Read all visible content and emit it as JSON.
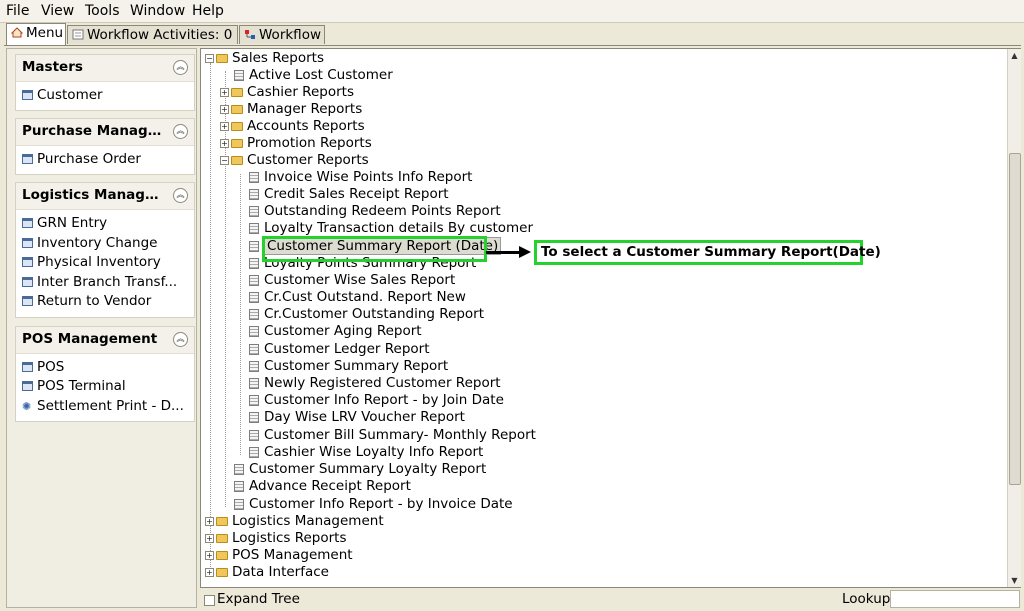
{
  "menubar": {
    "file": "File",
    "view": "View",
    "tools": "Tools",
    "window": "Window",
    "help": "Help"
  },
  "tabs": [
    {
      "label": "Menu",
      "icon": "home-icon"
    },
    {
      "label": "Workflow Activities: 0",
      "icon": "form-icon"
    },
    {
      "label": "Workflow",
      "icon": "workflow-icon"
    }
  ],
  "sidebar": {
    "sections": [
      {
        "title": "Masters",
        "items": [
          "Customer"
        ]
      },
      {
        "title": "Purchase Manage...",
        "items": [
          "Purchase Order"
        ]
      },
      {
        "title": "Logistics Managem...",
        "items": [
          "GRN Entry",
          "Inventory Change",
          "Physical Inventory",
          "Inter Branch Transf...",
          "Return to Vendor"
        ]
      },
      {
        "title": "POS Management",
        "items": [
          "POS",
          "POS Terminal",
          "Settlement Print - D..."
        ]
      }
    ]
  },
  "tree": {
    "sales_reports": "Sales Reports",
    "active_lost_customer": "Active Lost Customer",
    "cashier_reports": "Cashier Reports",
    "manager_reports": "Manager Reports",
    "accounts_reports": "Accounts Reports",
    "promotion_reports": "Promotion Reports",
    "customer_reports": "Customer Reports",
    "customer_report_items": [
      "Invoice Wise Points Info Report",
      "Credit Sales Receipt Report",
      "Outstanding Redeem Points Report",
      "Loyalty Transaction details By customer",
      "Customer Summary Report (Date)",
      "Loyalty Points Summary Report",
      "Customer Wise Sales Report",
      "Cr.Cust Outstand. Report New",
      "Cr.Customer Outstanding Report",
      "Customer Aging Report",
      "Customer Ledger Report",
      "Customer Summary Report",
      "Newly Registered Customer Report",
      "Customer Info Report - by Join Date",
      "Day Wise LRV Voucher Report",
      "Customer Bill Summary- Monthly Report",
      "Cashier Wise Loyalty Info Report"
    ],
    "customer_summary_loyalty": "Customer Summary Loyalty Report",
    "advance_receipt": "Advance Receipt Report",
    "customer_info_invoice_date": "Customer Info Report - by Invoice Date",
    "logistics_management": "Logistics Management",
    "logistics_reports": "Logistics Reports",
    "pos_management": "POS Management",
    "data_interface": "Data Interface"
  },
  "annotation": {
    "text": "To select a Customer Summary Report(Date)"
  },
  "bottom": {
    "expand_tree": "Expand Tree",
    "lookup": "Lookup",
    "lookup_value": ""
  }
}
